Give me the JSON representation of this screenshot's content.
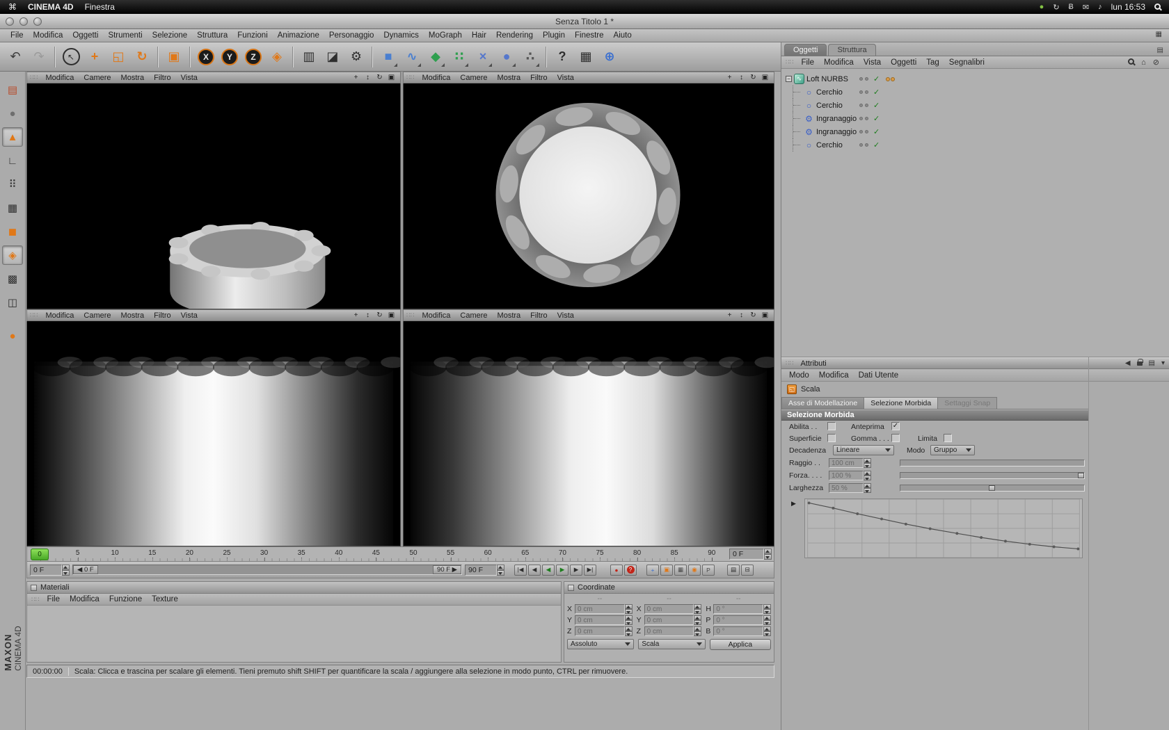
{
  "colors": {
    "accent_orange": "#e07818",
    "timeline_green": "#55c42e",
    "check_green": "#1d7d1d",
    "record_red": "#c22418"
  },
  "mac_menubar": {
    "apple_glyph": "⌘",
    "app_name": "CINEMA 4D",
    "window_menu": "Finestra",
    "clock": "lun 16:53",
    "status_icons": [
      {
        "name": "chat-status-icon",
        "glyph": "●",
        "color": "#8fd44a"
      },
      {
        "name": "sync-icon",
        "glyph": "↻"
      },
      {
        "name": "bluetooth-icon",
        "glyph": "Ƀ"
      },
      {
        "name": "mail-icon",
        "glyph": "✉"
      },
      {
        "name": "volume-icon",
        "glyph": "♪"
      }
    ]
  },
  "window": {
    "title": "Senza Titolo 1 *",
    "layout_icon": "▦"
  },
  "app_menu": [
    "File",
    "Modifica",
    "Oggetti",
    "Strumenti",
    "Selezione",
    "Struttura",
    "Funzioni",
    "Animazione",
    "Personaggio",
    "Dynamics",
    "MoGraph",
    "Hair",
    "Rendering",
    "Plugin",
    "Finestre",
    "Aiuto"
  ],
  "toolbar": [
    {
      "name": "undo-icon",
      "glyph": "↶",
      "color": "#3b3b3b"
    },
    {
      "name": "redo-icon",
      "glyph": "↷",
      "color": "#9a9a9a"
    },
    {
      "name": "sep"
    },
    {
      "name": "live-selection-tool",
      "glyph": "↖",
      "color": "#2f2f2f",
      "kind": "ring"
    },
    {
      "name": "move-tool",
      "glyph": "+",
      "color": "#e07818",
      "bold": true
    },
    {
      "name": "scale-tool",
      "glyph": "◱",
      "color": "#e07818"
    },
    {
      "name": "rotate-tool",
      "glyph": "↻",
      "color": "#e07818",
      "bold": true
    },
    {
      "name": "sep"
    },
    {
      "name": "last-tool-button",
      "glyph": "▣",
      "color": "#e07818"
    },
    {
      "name": "sep"
    },
    {
      "name": "lock-x-button",
      "glyph": "X",
      "kind": "axis"
    },
    {
      "name": "lock-y-button",
      "glyph": "Y",
      "kind": "axis"
    },
    {
      "name": "lock-z-button",
      "glyph": "Z",
      "kind": "axis"
    },
    {
      "name": "coordinate-system-button",
      "glyph": "◈",
      "color": "#e07818"
    },
    {
      "name": "sep"
    },
    {
      "name": "render-view-button",
      "glyph": "▥",
      "color": "#2e2e2e"
    },
    {
      "name": "render-region-button",
      "glyph": "◪",
      "color": "#2e2e2e"
    },
    {
      "name": "render-settings-button",
      "glyph": "⚙",
      "color": "#2e2e2e"
    },
    {
      "name": "sep"
    },
    {
      "name": "add-primitive-button",
      "glyph": "■",
      "color": "#4a7fd0",
      "corner": true
    },
    {
      "name": "add-spline-button",
      "glyph": "∿",
      "color": "#4a7fd0",
      "corner": true,
      "bold": true
    },
    {
      "name": "add-nurbs-button",
      "glyph": "◆",
      "color": "#2f9f4f",
      "corner": true
    },
    {
      "name": "add-array-button",
      "glyph": "∷",
      "color": "#2f9f4f",
      "corner": true,
      "bold": true
    },
    {
      "name": "add-deformer-button",
      "glyph": "×",
      "color": "#5577cc",
      "corner": true,
      "bold": true
    },
    {
      "name": "add-scene-button",
      "glyph": "●",
      "color": "#5577cc",
      "corner": true
    },
    {
      "name": "add-particles-button",
      "glyph": "∴",
      "color": "#555555",
      "corner": true,
      "bold": true
    },
    {
      "name": "sep"
    },
    {
      "name": "help-button",
      "glyph": "?",
      "color": "#2e2e2e",
      "bold": true
    },
    {
      "name": "content-browser-button",
      "glyph": "▦",
      "color": "#2e2e2e"
    },
    {
      "name": "online-browser-button",
      "glyph": "⊕",
      "color": "#3a6fd0",
      "bold": true
    }
  ],
  "palette": [
    {
      "name": "make-editable-button",
      "glyph": "▤",
      "color": "#b84a2a"
    },
    {
      "name": "model-mode-button",
      "glyph": "●",
      "color": "#6e6e6e"
    },
    {
      "name": "object-mode-button",
      "glyph": "▲",
      "color": "#e07818",
      "active": true
    },
    {
      "name": "object-axis-button",
      "glyph": "∟",
      "color": "#2f2f2f",
      "bold": true
    },
    {
      "name": "point-mode-button",
      "glyph": "⠿",
      "color": "#2f2f2f"
    },
    {
      "name": "edge-mode-button",
      "glyph": "▦",
      "color": "#2f2f2f"
    },
    {
      "name": "polygon-mode-button",
      "glyph": "◼",
      "color": "#e07818"
    },
    {
      "name": "texture-mode-button",
      "glyph": "◈",
      "color": "#e07818",
      "active": true
    },
    {
      "name": "texture-axis-button",
      "glyph": "▩",
      "color": "#2f2f2f"
    },
    {
      "name": "workplane-button",
      "glyph": "◫",
      "color": "#2f2f2f"
    },
    {
      "name": "gap"
    },
    {
      "name": "viewport-filter-button",
      "glyph": "●",
      "color": "#e07818"
    }
  ],
  "viewport": {
    "menu": [
      "Modifica",
      "Camere",
      "Mostra",
      "Filtro",
      "Vista"
    ],
    "icons": [
      {
        "name": "pan-view-icon",
        "glyph": "+"
      },
      {
        "name": "zoom-view-icon",
        "glyph": "↕"
      },
      {
        "name": "rotate-view-icon",
        "glyph": "↻"
      },
      {
        "name": "maximize-view-icon",
        "glyph": "▣"
      }
    ]
  },
  "timeline": {
    "ticks": [
      0,
      5,
      10,
      15,
      20,
      25,
      30,
      35,
      40,
      45,
      50,
      55,
      60,
      65,
      70,
      75,
      80,
      85,
      90
    ],
    "playhead": "0",
    "ruler_frame_field": "0 F",
    "start_field": "0 F",
    "range_start": "◀ 0 F",
    "range_end": "90 F ▶",
    "end_field": "90 F",
    "transport": [
      {
        "name": "goto-start-button",
        "glyph": "|◀"
      },
      {
        "name": "prev-key-button",
        "glyph": "◀"
      },
      {
        "name": "play-backward-button",
        "glyph": "◀",
        "color": "#1d7d1d"
      },
      {
        "name": "play-button",
        "glyph": "▶",
        "color": "#1d7d1d"
      },
      {
        "name": "next-key-button",
        "glyph": "▶"
      },
      {
        "name": "goto-end-button",
        "glyph": "▶|"
      }
    ],
    "record_buttons": [
      {
        "name": "record-keyframe-button",
        "glyph": "●",
        "color": "#c22418"
      },
      {
        "name": "autokey-button",
        "glyph": "?",
        "badge": true
      }
    ],
    "key_toggles": [
      {
        "name": "record-position-toggle",
        "glyph": "+",
        "color": "#3a6fd0"
      },
      {
        "name": "record-scale-toggle",
        "glyph": "▣",
        "color": "#e07818"
      },
      {
        "name": "record-rotation-toggle",
        "glyph": "▦",
        "color": "#4a4a4a"
      },
      {
        "name": "record-parameter-toggle",
        "glyph": "◉",
        "color": "#e07818"
      },
      {
        "name": "record-pla-toggle",
        "glyph": "P",
        "color": "#4a4a4a"
      }
    ],
    "extra_buttons": [
      {
        "name": "keyframe-selection-button",
        "glyph": "▤"
      },
      {
        "name": "timeline-options-button",
        "glyph": "⊟"
      }
    ]
  },
  "materials": {
    "title": "Materiali",
    "menu": [
      "File",
      "Modifica",
      "Funzione",
      "Texture"
    ]
  },
  "coordinates": {
    "title": "Coordinate",
    "col_headers": [
      "--",
      "--",
      "--"
    ],
    "cols": [
      {
        "rows": [
          {
            "label": "X",
            "value": "0 cm"
          },
          {
            "label": "Y",
            "value": "0 cm"
          },
          {
            "label": "Z",
            "value": "0 cm"
          }
        ]
      },
      {
        "rows": [
          {
            "label": "X",
            "value": "0 cm"
          },
          {
            "label": "Y",
            "value": "0 cm"
          },
          {
            "label": "Z",
            "value": "0 cm"
          }
        ]
      },
      {
        "rows": [
          {
            "label": "H",
            "value": "0 °"
          },
          {
            "label": "P",
            "value": "0 °"
          },
          {
            "label": "B",
            "value": "0 °"
          }
        ]
      }
    ],
    "mode_dropdown": "Assoluto",
    "action_dropdown": "Scala",
    "apply_button": "Applica"
  },
  "object_manager": {
    "tabs": [
      {
        "label": "Oggetti",
        "active": true
      },
      {
        "label": "Struttura",
        "active": false
      }
    ],
    "panel_icon": "▤",
    "menu": [
      "File",
      "Modifica",
      "Vista",
      "Oggetti",
      "Tag",
      "Segnalibri"
    ],
    "right_icons": [
      {
        "name": "search-icon",
        "kind": "mag"
      },
      {
        "name": "home-icon",
        "glyph": "⌂"
      },
      {
        "name": "filter-icon",
        "glyph": "⊘"
      }
    ],
    "check_glyph": "✓",
    "expander_glyph": "−",
    "tree": [
      {
        "label": "Loft NURBS",
        "level": 0,
        "icon": "loft",
        "glyph": "∿",
        "tag": true
      },
      {
        "label": "Cerchio",
        "level": 1,
        "icon": "circle",
        "glyph": "○"
      },
      {
        "label": "Cerchio",
        "level": 1,
        "icon": "circle",
        "glyph": "○"
      },
      {
        "label": "Ingranaggio",
        "level": 1,
        "icon": "gear",
        "glyph": "⚙"
      },
      {
        "label": "Ingranaggio",
        "level": 1,
        "icon": "gear",
        "glyph": "⚙"
      },
      {
        "label": "Cerchio",
        "level": 1,
        "icon": "circle",
        "glyph": "○"
      }
    ]
  },
  "attributes": {
    "title": "Attributi",
    "header_icons": [
      {
        "name": "history-back-icon",
        "glyph": "◀"
      },
      {
        "name": "lock-icon",
        "kind": "lock"
      },
      {
        "name": "snapshot-icon",
        "glyph": "▤"
      },
      {
        "name": "panel-menu-icon",
        "glyph": "▾"
      }
    ],
    "menu": [
      "Modo",
      "Modifica",
      "Dati Utente"
    ],
    "tool_title": "Scala",
    "tool_icon_glyph": "◱",
    "tabs": [
      {
        "label": "Asse di Modellazione",
        "state": "normal"
      },
      {
        "label": "Selezione Morbida",
        "state": "active"
      },
      {
        "label": "Settaggi Snap",
        "state": "disabled"
      }
    ],
    "section_title": "Selezione Morbida",
    "check_glyph": "✓",
    "rows": {
      "abilita_label": "Abilita . .",
      "abilita_checked": false,
      "anteprima_label": "Anteprima",
      "anteprima_checked": true,
      "superficie_label": "Superficie",
      "superficie_checked": false,
      "gomma_label": "Gomma . . .",
      "gomma_checked": false,
      "limita_label": "Limita",
      "limita_checked": false,
      "decadenza_label": "Decadenza",
      "decadenza_value": "Lineare",
      "modo_label": "Modo",
      "modo_value": "Gruppo",
      "raggio_label": "Raggio . .",
      "raggio_value": "100 cm",
      "forza_label": "Forza. . . .",
      "forza_value": "100 %",
      "forza_slider": 1,
      "larghezza_label": "Larghezza",
      "larghezza_value": "50 %",
      "larghezza_slider": 0.5
    },
    "falloff_curve": {
      "expander_glyph": "▶",
      "points": [
        [
          0,
          0.02
        ],
        [
          0.09,
          0.12
        ],
        [
          0.18,
          0.23
        ],
        [
          0.27,
          0.33
        ],
        [
          0.36,
          0.43
        ],
        [
          0.45,
          0.52
        ],
        [
          0.55,
          0.61
        ],
        [
          0.64,
          0.69
        ],
        [
          0.73,
          0.76
        ],
        [
          0.82,
          0.82
        ],
        [
          0.91,
          0.87
        ],
        [
          1,
          0.91
        ]
      ]
    }
  },
  "status_bar": {
    "time": "00:00:00",
    "message": "Scala: Clicca e trascina per scalare gli elementi. Tieni premuto shift SHIFT per quantificare la scala / aggiungere alla selezione in modo punto, CTRL per rimuovere."
  },
  "brand": {
    "line1": "MAXON",
    "line2": "CINEMA 4D"
  }
}
